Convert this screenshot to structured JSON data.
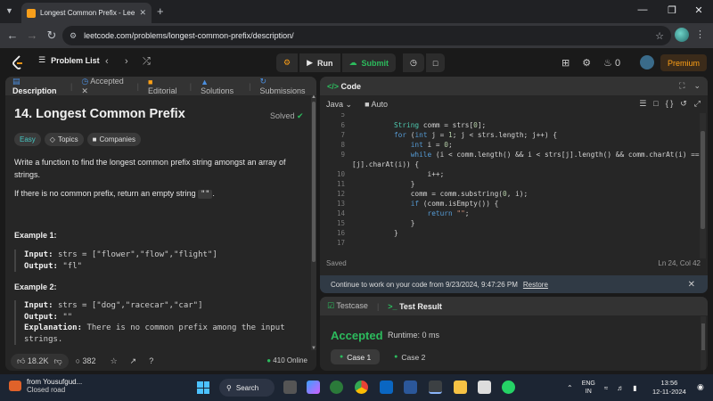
{
  "browser": {
    "tab_title": "Longest Common Prefix - LeetC",
    "url": "leetcode.com/problems/longest-common-prefix/description/"
  },
  "nav": {
    "problem_list": "Problem List",
    "run": "Run",
    "submit": "Submit",
    "streak": "0",
    "premium": "Premium"
  },
  "desc_tabs": {
    "description": "Description",
    "accepted": "Accepted",
    "editorial": "Editorial",
    "solutions": "Solutions",
    "submissions": "Submissions"
  },
  "problem": {
    "title": "14. Longest Common Prefix",
    "status": "Solved",
    "difficulty": "Easy",
    "topics": "Topics",
    "companies": "Companies",
    "statement": "Write a function to find the longest common prefix string amongst an array of strings.",
    "note_prefix": "If there is no common prefix, return an empty string",
    "note_code": "\"\"",
    "note_suffix": ".",
    "examples": [
      {
        "heading": "Example 1:",
        "input_label": "Input:",
        "input": "strs = [\"flower\",\"flow\",\"flight\"]",
        "output_label": "Output:",
        "output": "\"fl\""
      },
      {
        "heading": "Example 2:",
        "input_label": "Input:",
        "input": "strs = [\"dog\",\"racecar\",\"car\"]",
        "output_label": "Output:",
        "output": "\"\"",
        "explanation_label": "Explanation:",
        "explanation": "There is no common prefix among the input strings."
      }
    ]
  },
  "desc_footer": {
    "likes": "18.2K",
    "comments": "382",
    "online": "410 Online"
  },
  "code_panel": {
    "title": "Code",
    "language": "Java",
    "mode": "Auto",
    "saved": "Saved",
    "cursor": "Ln 24, Col 42",
    "restore_msg": "Continue to work on your code from 9/23/2024, 9:47:26 PM",
    "restore_link": "Restore",
    "line_numbers": [
      "5",
      "6",
      "7",
      "8",
      "9",
      "",
      "10",
      "11",
      "12",
      "13",
      "14",
      "15",
      "16",
      "17"
    ]
  },
  "test_panel": {
    "testcase": "Testcase",
    "test_result": "Test Result",
    "result": "Accepted",
    "runtime": "Runtime: 0 ms",
    "case1": "Case 1",
    "case2": "Case 2"
  },
  "taskbar": {
    "weather_title": "from Yousufgud...",
    "weather_sub": "Closed road",
    "search": "Search",
    "lang1": "ENG",
    "lang2": "IN",
    "time": "13:56",
    "date": "12-11-2024"
  },
  "colors": {
    "accent": "#ffa116",
    "success": "#2cbb5d",
    "easy": "#46c6c2"
  }
}
